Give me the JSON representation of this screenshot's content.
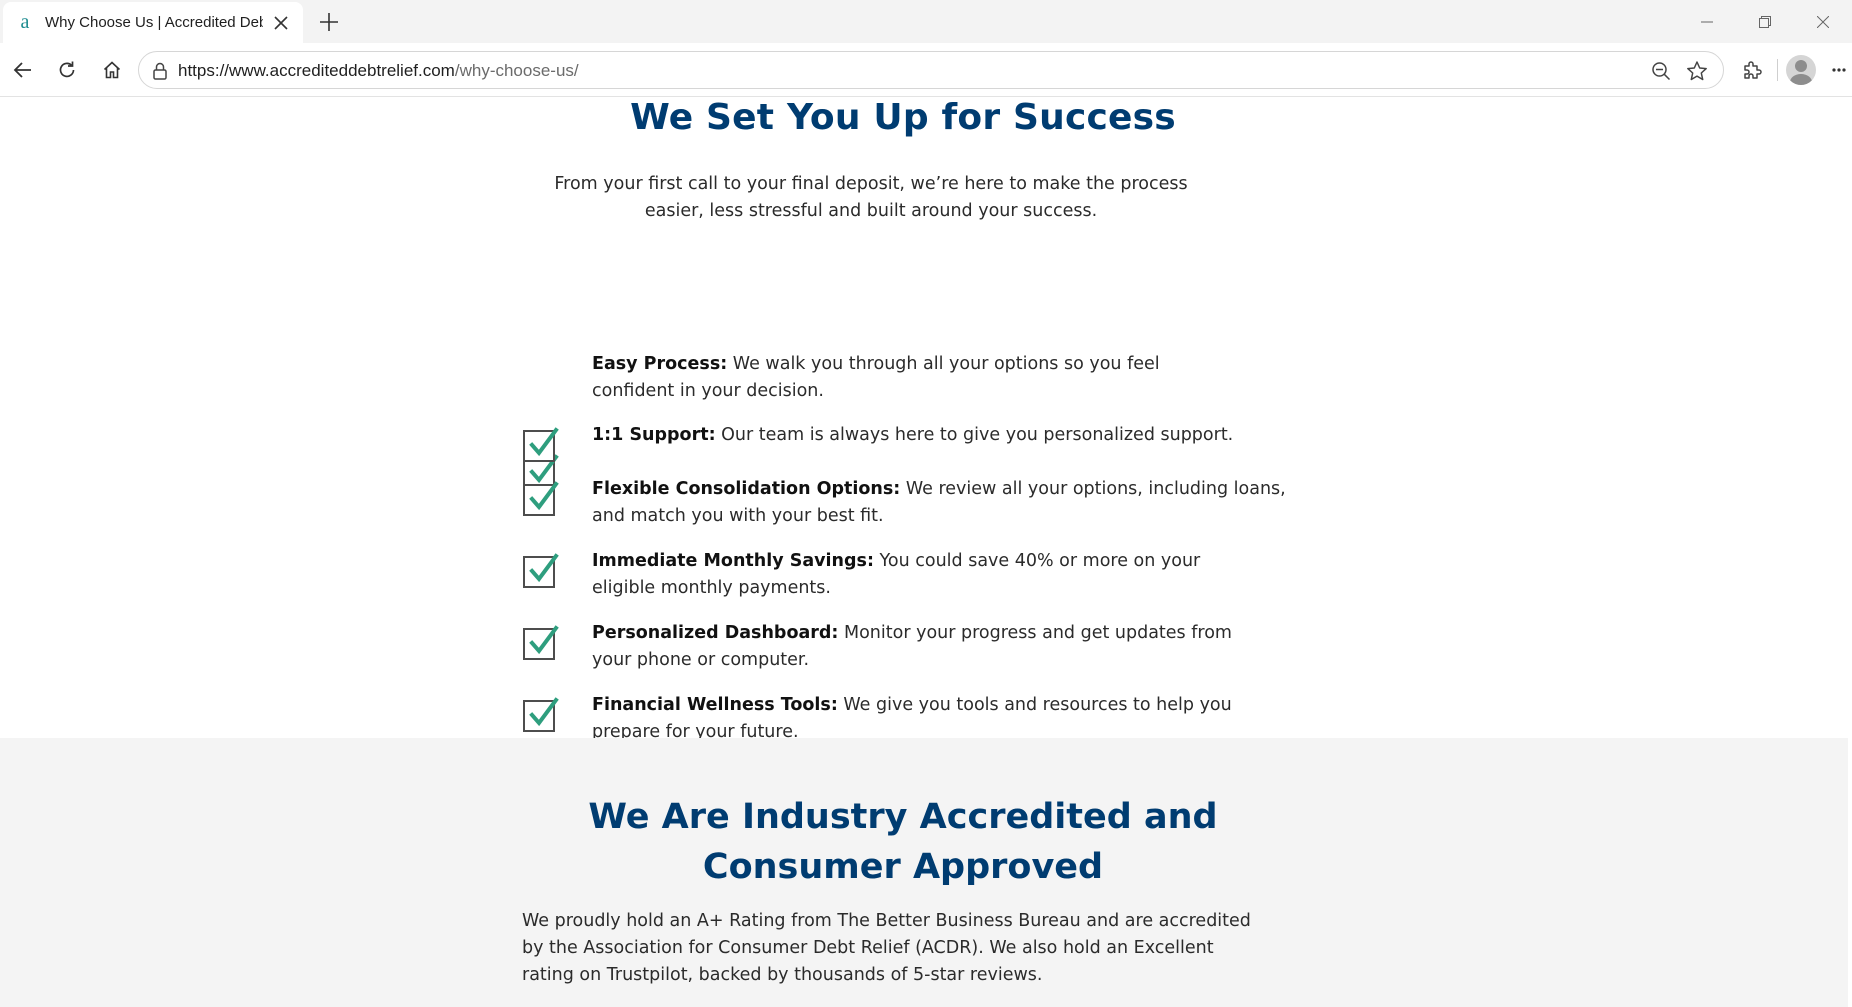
{
  "browser": {
    "tab_title": "Why Choose Us | Accredited Debt",
    "tab_favicon_letter": "a",
    "url_host": "https://www.accrediteddebtrelief.com",
    "url_path": "/why-choose-us/"
  },
  "icons": {
    "back": "back-arrow-icon",
    "refresh": "refresh-icon",
    "home": "home-icon",
    "lock": "lock-icon",
    "zoom": "zoom-out-icon",
    "favorite": "star-icon",
    "extensions": "puzzle-icon",
    "profile": "avatar",
    "menu": "more-icon"
  },
  "colors": {
    "heading": "#003c71",
    "check": "#2e9e7e",
    "section_bg": "#f4f4f4"
  },
  "success": {
    "heading": "We Set You Up for Success",
    "intro_line1": "From your first call to your final deposit, we’re here to make the process",
    "intro_line2": "easier, less stressful and built around your success."
  },
  "features": [
    {
      "title": "Easy Process:",
      "text_line1": " We walk you through all your options so you feel",
      "text_line2": "confident in your decision."
    },
    {
      "title": "1:1 Support:",
      "text_line1": " Our team is always here to give you personalized support.",
      "text_line2": ""
    },
    {
      "title": "Flexible Consolidation Options:",
      "text_line1": " We review all your options, including loans,",
      "text_line2": "and match you with your best fit."
    },
    {
      "title": "Immediate Monthly Savings:",
      "text_line1": " You could save 40% or more on your",
      "text_line2": "eligible monthly payments."
    },
    {
      "title": "Personalized Dashboard:",
      "text_line1": " Monitor your progress and get updates from",
      "text_line2": "your phone or computer."
    },
    {
      "title": "Financial Wellness Tools:",
      "text_line1": " We give you tools and resources to help you",
      "text_line2": "prepare for your future."
    }
  ],
  "accredited": {
    "heading_line1": "We Are Industry Accredited and",
    "heading_line2": "Consumer Approved",
    "text_line1": "We proudly hold an A+ Rating from The Better Business Bureau and are accredited",
    "text_line2": "by the Association for Consumer Debt Relief (ACDR). We also hold an Excellent",
    "text_line3": "rating on Trustpilot, backed by thousands of 5-star reviews."
  }
}
